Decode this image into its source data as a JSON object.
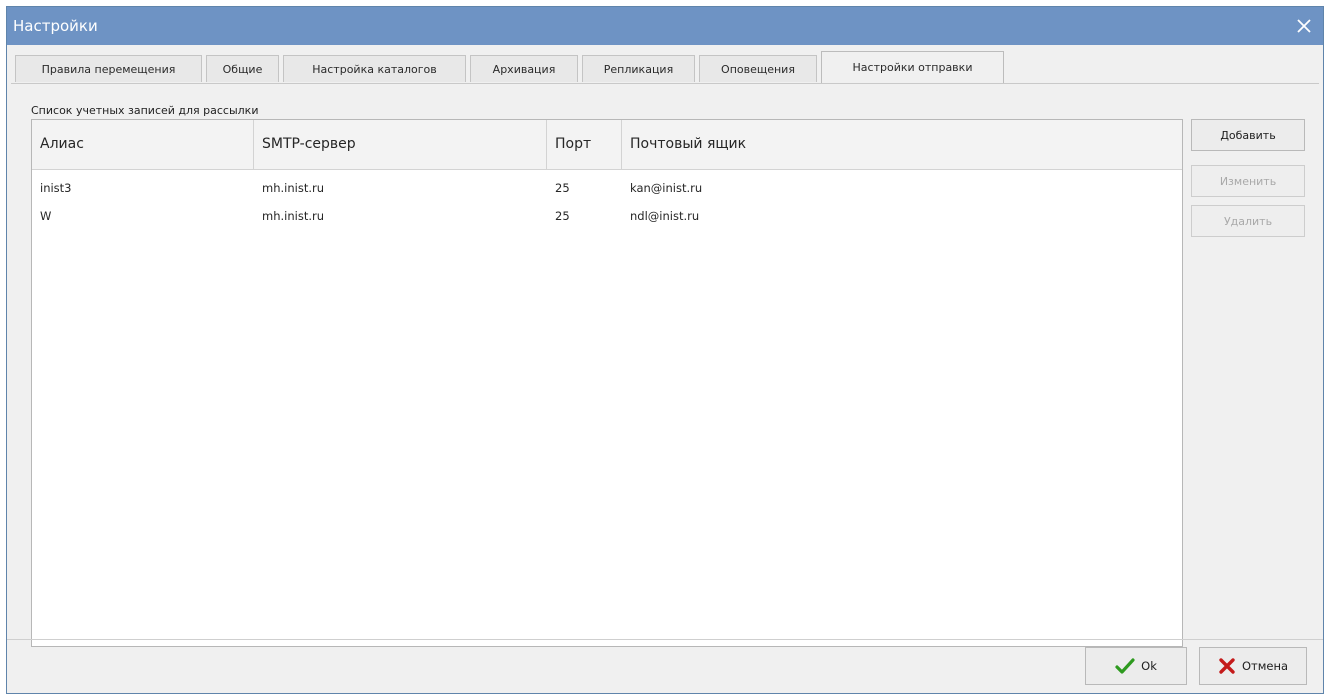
{
  "window": {
    "title": "Настройки"
  },
  "tabs": [
    {
      "label": "Правила перемещения"
    },
    {
      "label": "Общие"
    },
    {
      "label": "Настройка каталогов"
    },
    {
      "label": "Архивация"
    },
    {
      "label": "Репликация"
    },
    {
      "label": "Оповещения"
    },
    {
      "label": "Настройки отправки",
      "active": true
    }
  ],
  "accounts": {
    "section_label": "Список учетных записей для рассылки",
    "columns": {
      "alias": "Алиас",
      "smtp": "SMTP-сервер",
      "port": "Порт",
      "mailbox": "Почтовый ящик"
    },
    "rows": [
      {
        "alias": "inist3",
        "smtp": "mh.inist.ru",
        "port": "25",
        "mailbox": "kan@inist.ru"
      },
      {
        "alias": "W",
        "smtp": "mh.inist.ru",
        "port": "25",
        "mailbox": "ndl@inist.ru"
      }
    ]
  },
  "buttons": {
    "add": "Добавить",
    "edit": "Изменить",
    "delete": "Удалить",
    "ok": "Ok",
    "cancel": "Отмена"
  },
  "colors": {
    "titlebar": "#6e93c4",
    "ok_icon": "#2e9a1f",
    "cancel_icon": "#c41a1a"
  }
}
